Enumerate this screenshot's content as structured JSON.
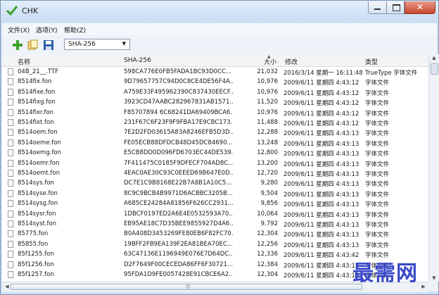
{
  "window": {
    "title": "CHK"
  },
  "menu": [
    {
      "label": "文件(X)"
    },
    {
      "label": "选项(Y)"
    },
    {
      "label": "帮助(Z)"
    }
  ],
  "toolbar": {
    "add_icon": "add-plus-icon",
    "folder_icon": "open-folder-icon",
    "save_icon": "save-disk-icon",
    "hash_select": "SHA-256"
  },
  "table": {
    "columns": [
      "名称",
      "SHA-256",
      "大小",
      "修改",
      "类型"
    ],
    "rows": [
      [
        "04B_21__.TTF",
        "598CA776E0FB5FADA1BC93D0CC...",
        "21,032",
        "2016/3/14 星期一 16:11:48",
        "TrueType 字体文件"
      ],
      [
        "8514fix.fon",
        "9D79657757C94D0C8CE4DE56F4A...",
        "10,976",
        "2009/6/11 星期四 4:43:12",
        "字体文件"
      ],
      [
        "8514fixe.fon",
        "A759E33F495962390C837430EECF...",
        "10,976",
        "2009/6/11 星期四 4:43:12",
        "字体文件"
      ],
      [
        "8514fixg.fon",
        "3923CD47AABC282967831AB1571...",
        "11,520",
        "2009/6/11 星期四 4:43:12",
        "字体文件"
      ],
      [
        "8514fixr.fon",
        "F85707894 6C68241DA69409BCA6...",
        "10,976",
        "2009/6/11 星期四 4:43:12",
        "字体文件"
      ],
      [
        "8514fixt.fon",
        "231F67C6F23F9F9FBA17E9CBC173...",
        "11,488",
        "2009/6/11 星期四 4:43:12",
        "字体文件"
      ],
      [
        "8514oem.fon",
        "7E2D2FD03615A83A8246EFB5D3D...",
        "12,288",
        "2009/6/11 星期四 4:43:13",
        "字体文件"
      ],
      [
        "8514oeme.fon",
        "FE05ECB88DFDCB48D45DC84690...",
        "13,248",
        "2009/6/11 星期四 4:43:13",
        "字体文件"
      ],
      [
        "8514oemg.fon",
        "E5CB8DD0D096FD6703EC44DE539...",
        "12,800",
        "2009/6/11 星期四 4:43:13",
        "字体文件"
      ],
      [
        "8514oemr.fon",
        "7F411475C0185F9DFECF704AD8C...",
        "13,200",
        "2009/6/11 星期四 4:43:13",
        "字体文件"
      ],
      [
        "8514oemt.fon",
        "4EAC0AE30C93C0EEED69B647E0D...",
        "12,720",
        "2009/6/11 星期四 4:43:13",
        "字体文件"
      ],
      [
        "8514sys.fon",
        "DC7E1C9B8168E22B7A8B1A10C5...",
        "9,280",
        "2009/6/11 星期四 4:43:13",
        "字体文件"
      ],
      [
        "8514syse.fon",
        "8C9C9BCB4B9971D6ACBBC3205B...",
        "9,504",
        "2009/6/11 星期四 4:43:13",
        "字体文件"
      ],
      [
        "8514sysg.fon",
        "A685CE24284A81856F626CC2931...",
        "9,856",
        "2009/6/11 星期四 4:43:13",
        "字体文件"
      ],
      [
        "8514sysr.fon",
        "1DBCF0197ED2A6E4E0532593A70...",
        "10,064",
        "2009/6/11 星期四 4:43:13",
        "字体文件"
      ],
      [
        "8514syst.fon",
        "EB95AE18C7D35BEE9855927D4A6...",
        "9,792",
        "2009/6/11 星期四 4:43:13",
        "字体文件"
      ],
      [
        "85775.fon",
        "B0A408D3453269FE80EB6F82FC70...",
        "12,304",
        "2009/6/11 星期四 4:43:13",
        "字体文件"
      ],
      [
        "85855.fon",
        "19BFF2FB9EA139F2EA81BEA70EC...",
        "12,256",
        "2009/6/11 星期四 4:43:13",
        "字体文件"
      ],
      [
        "85f1255.fon",
        "63C47136E1196949E076E7D64DC...",
        "12,336",
        "2009/6/11 星期四 4:43:42",
        "字体文件"
      ],
      [
        "85f1256.fon",
        "D2F7649F00CECEDA86FF6F30721...",
        "12,384",
        "2009/6/11 星期四 4:43:13",
        "字体文件"
      ],
      [
        "85f1257.fon",
        "95FDA1D9FE0057428E91CBCE6A2...",
        "12,304",
        "2009/6/11 星期四 4:43:13",
        "字体文件"
      ]
    ]
  },
  "watermark": "最需网"
}
